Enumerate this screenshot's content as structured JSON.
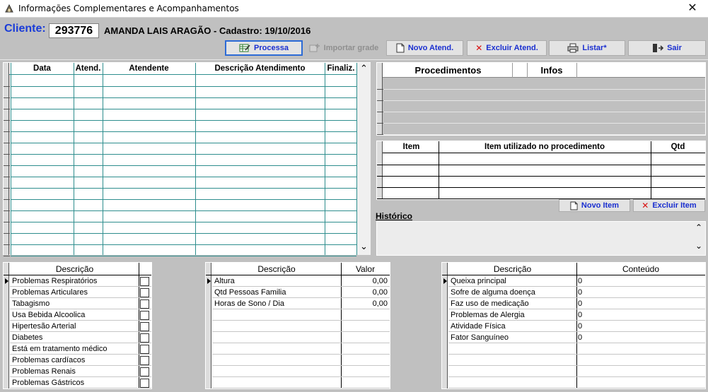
{
  "window": {
    "title": "Informações Complementares e Acompanhamentos",
    "close_glyph": "✕"
  },
  "client": {
    "label": "Cliente:",
    "id": "293776",
    "name": "AMANDA LAIS ARAGÃO - Cadastro: 19/10/2016"
  },
  "toolbar": {
    "processa": "Processa",
    "importar_grade": "Importar grade",
    "novo_atend": "Novo Atend.",
    "excluir_atend": "Excluir Atend.",
    "listar": "Listar*",
    "sair": "Sair"
  },
  "atendimentos": {
    "columns": [
      "Data",
      "Atend.",
      "Atendente",
      "Descrição Atendimento",
      "Finaliz."
    ],
    "scroll_up": "⌃",
    "scroll_down": "⌄"
  },
  "procedimentos": {
    "columns": [
      "Procedimentos",
      "Infos"
    ]
  },
  "itens": {
    "columns": [
      "Item",
      "Item utilizado no procedimento",
      "Qtd"
    ],
    "novo_item": "Novo Item",
    "excluir_item": "Excluir Item"
  },
  "historico": {
    "label": "Histórico"
  },
  "condicoes": {
    "header": "Descrição",
    "rows": [
      "Problemas Respiratórios",
      "Problemas Articulares",
      "Tabagismo",
      "Usa Bebida Alcoolica",
      "Hipertesão Arterial",
      "Diabetes",
      "Está em tratamento médico",
      "Problemas cardíacos",
      "Problemas Renais",
      "Problemas Gástricos"
    ]
  },
  "medidas": {
    "headers": [
      "Descrição",
      "Valor"
    ],
    "rows": [
      {
        "desc": "Altura",
        "valor": "0,00"
      },
      {
        "desc": "Qtd Pessoas Familia",
        "valor": "0,00"
      },
      {
        "desc": "Horas de Sono / Dia",
        "valor": "0,00"
      }
    ]
  },
  "anamnese": {
    "headers": [
      "Descrição",
      "Conteúdo"
    ],
    "rows": [
      {
        "desc": "Queixa principal",
        "conteudo": "0"
      },
      {
        "desc": "Sofre de alguma doença",
        "conteudo": "0"
      },
      {
        "desc": "Faz uso de medicação",
        "conteudo": "0"
      },
      {
        "desc": "Problemas de Alergia",
        "conteudo": "0"
      },
      {
        "desc": "Atividade Física",
        "conteudo": "0"
      },
      {
        "desc": "Fator Sanguíneo",
        "conteudo": "0"
      }
    ]
  }
}
